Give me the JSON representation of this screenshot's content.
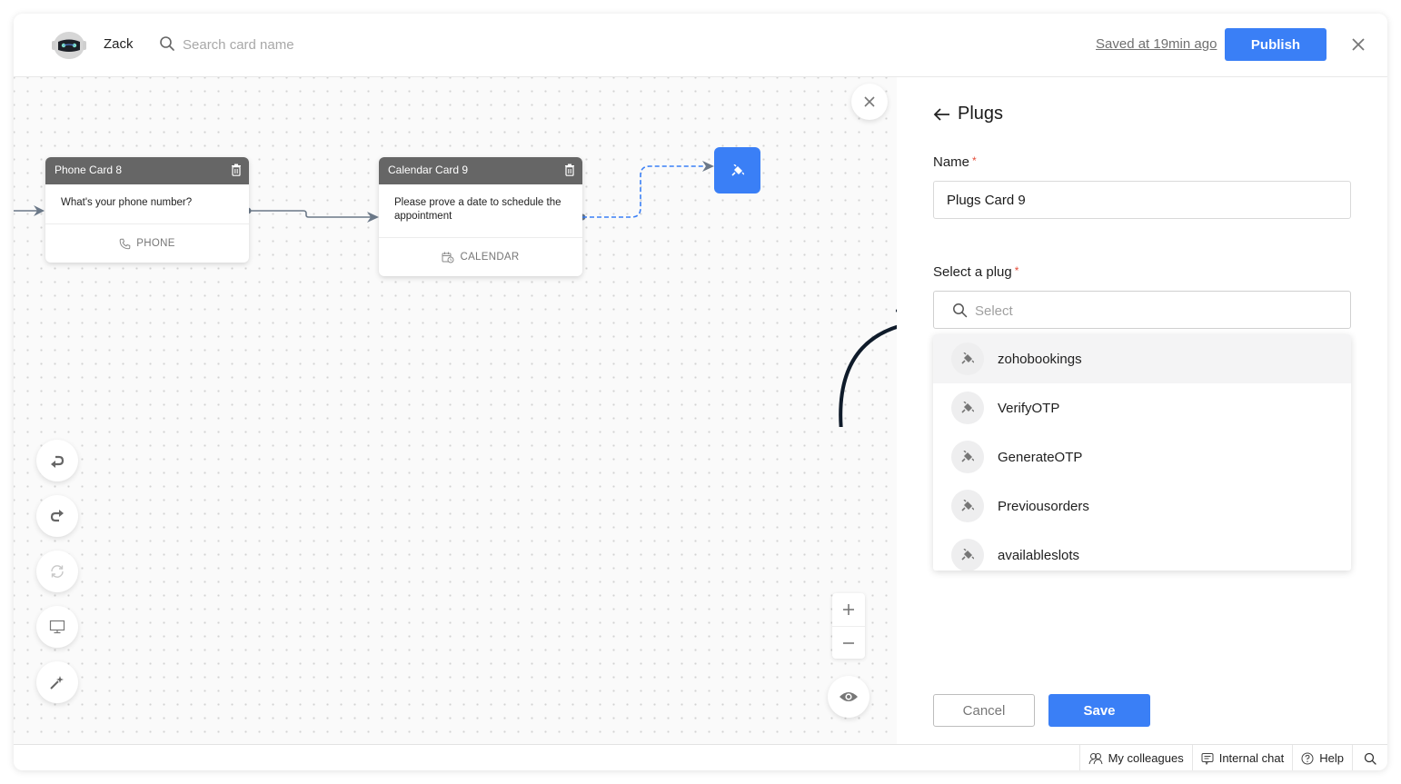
{
  "header": {
    "bot_name": "Zack",
    "search_placeholder": "Search card name",
    "saved_status": "Saved at 19min ago",
    "publish_label": "Publish"
  },
  "canvas": {
    "cards": [
      {
        "title": "Phone Card 8",
        "message": "What's your phone number?",
        "type_label": "PHONE",
        "type_icon": "phone-icon"
      },
      {
        "title": "Calendar Card 9",
        "message": "Please prove a date to schedule the appointment",
        "type_label": "CALENDAR",
        "type_icon": "calendar-icon"
      }
    ],
    "plug_node_icon": "plug-icon",
    "left_tools": [
      {
        "name": "undo",
        "icon": "undo-icon"
      },
      {
        "name": "redo",
        "icon": "redo-icon"
      },
      {
        "name": "refresh",
        "icon": "refresh-icon"
      },
      {
        "name": "preview-desktop",
        "icon": "monitor-icon"
      },
      {
        "name": "magic",
        "icon": "magic-wand-icon"
      }
    ],
    "zoom_in": "+",
    "zoom_out": "−"
  },
  "panel": {
    "title": "Plugs",
    "name_label": "Name",
    "name_value": "Plugs Card 9",
    "select_label": "Select a plug",
    "select_placeholder": "Select",
    "required_mark": "*",
    "plugs": [
      {
        "label": "zohobookings",
        "highlighted": true
      },
      {
        "label": "VerifyOTP",
        "highlighted": false
      },
      {
        "label": "GenerateOTP",
        "highlighted": false
      },
      {
        "label": "Previousorders",
        "highlighted": false
      },
      {
        "label": "availableslots",
        "highlighted": false
      }
    ],
    "cancel_label": "Cancel",
    "save_label": "Save"
  },
  "footer": {
    "items": [
      {
        "label": "My colleagues",
        "icon": "colleagues-icon"
      },
      {
        "label": "Internal chat",
        "icon": "chat-icon"
      },
      {
        "label": "Help",
        "icon": "help-icon"
      }
    ]
  },
  "colors": {
    "accent": "#3a7ff6",
    "card_header": "#666666",
    "required": "#e44d3a",
    "annotation_arrow": "#0f1b2a"
  }
}
